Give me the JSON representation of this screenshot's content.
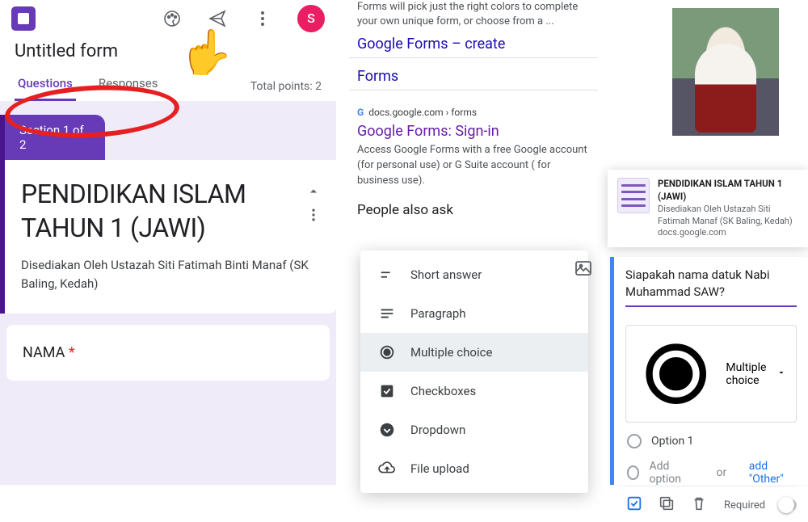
{
  "left": {
    "untitled": "Untitled form",
    "avatar_initial": "S",
    "tabs": {
      "questions": "Questions",
      "responses": "Responses"
    },
    "total_points": "Total points: 2",
    "section_badge": "Section 1 of 2",
    "form_title": "PENDIDIKAN ISLAM TAHUN 1 (JAWI)",
    "form_desc": "Disediakan Oleh Ustazah Siti Fatimah Binti Manaf (SK Baling,  Kedah)",
    "q1_label": "NAMA",
    "required_mark": "*"
  },
  "mid": {
    "snippet_top": "Forms will pick just the right colors to complete your own unique form, or choose from a ...",
    "link_create": "Google Forms – create",
    "link_forms": "Forms",
    "crumb": "docs.google.com › forms",
    "link_signin": "Google Forms: Sign-in",
    "snippet_signin": "Access Google Forms with a free Google account (for personal use) or G Suite account ( for business use).",
    "paa_heading": "People also ask",
    "qtypes": {
      "short_answer": "Short answer",
      "paragraph": "Paragraph",
      "multiple_choice": "Multiple choice",
      "checkboxes": "Checkboxes",
      "dropdown": "Dropdown",
      "file_upload": "File upload"
    }
  },
  "right": {
    "card_title": "PENDIDIKAN ISLAM TAHUN 1 (JAWI)",
    "card_sub": "Disediakan Oleh Ustazah Siti Fatimah Manaf (SK Baling, Kedah)",
    "card_domain": "docs.google.com",
    "question_text": "Siapakah nama datuk Nabi Muhammad SAW?",
    "type_selected": "Multiple choice",
    "option1": "Option 1",
    "add_option": "Add option",
    "or_word": "or",
    "add_other": "add \"Other\"",
    "required_label": "Required"
  }
}
